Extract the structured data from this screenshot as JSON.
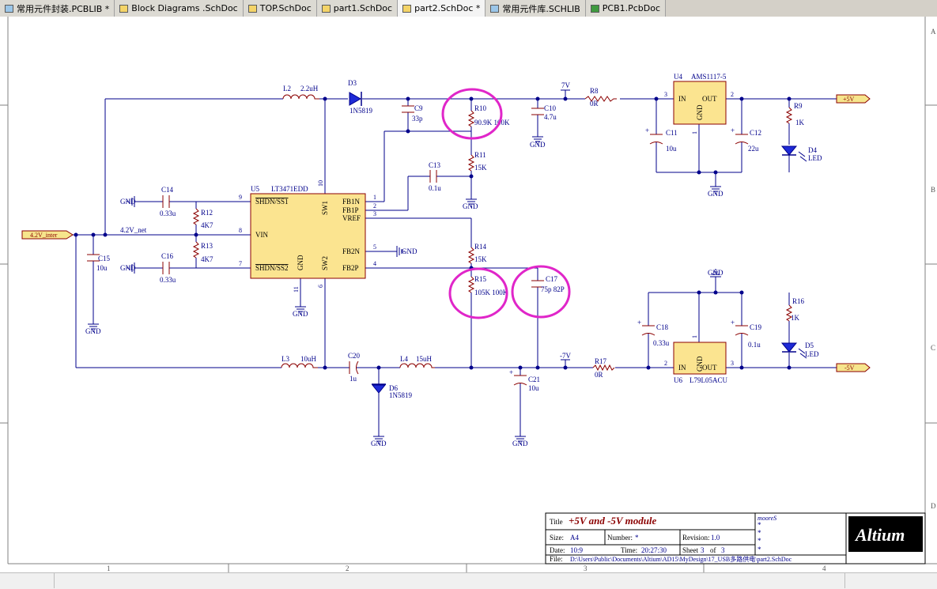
{
  "tabs": [
    {
      "label": "常用元件封装.PCBLIB *",
      "icon": "pcblib-icon",
      "active": false
    },
    {
      "label": "Block Diagrams .SchDoc",
      "icon": "schdoc-icon",
      "active": false
    },
    {
      "label": "TOP.SchDoc",
      "icon": "schdoc-icon",
      "active": false
    },
    {
      "label": "part1.SchDoc",
      "icon": "schdoc-icon",
      "active": false
    },
    {
      "label": "part2.SchDoc *",
      "icon": "schdoc-icon",
      "active": true
    },
    {
      "label": "常用元件库.SCHLIB",
      "icon": "schlib-icon",
      "active": false
    },
    {
      "label": "PCB1.PcbDoc",
      "icon": "pcbdoc-icon",
      "active": false
    }
  ],
  "border": {
    "cols": [
      "1",
      "2",
      "3",
      "4"
    ],
    "rows": [
      "A",
      "B",
      "C",
      "D"
    ]
  },
  "components": {
    "L2": {
      "ref": "L2",
      "val": "2.2uH"
    },
    "D3": {
      "ref": "D3",
      "val": "1N5819"
    },
    "C9": {
      "ref": "C9",
      "val": "33p"
    },
    "R10": {
      "ref": "R10",
      "val": "90.9K 100K"
    },
    "C10": {
      "ref": "C10",
      "val": "4.7u"
    },
    "R8": {
      "ref": "R8",
      "val": "0R"
    },
    "U4": {
      "ref": "U4",
      "val": "AMS1117-5",
      "in": "IN",
      "out": "OUT",
      "gnd": "GND"
    },
    "C11": {
      "ref": "C11",
      "val": "10u"
    },
    "C12": {
      "ref": "C12",
      "val": "22u"
    },
    "R9": {
      "ref": "R9",
      "val": "1K"
    },
    "D4": {
      "ref": "D4",
      "val": "LED"
    },
    "R11": {
      "ref": "R11",
      "val": "15K"
    },
    "C13": {
      "ref": "C13",
      "val": "0.1u"
    },
    "U5": {
      "ref": "U5",
      "val": "LT3471EDD"
    },
    "C14": {
      "ref": "C14",
      "val": "0.33u"
    },
    "R12": {
      "ref": "R12",
      "val": "4K7"
    },
    "R13": {
      "ref": "R13",
      "val": "4K7"
    },
    "C16": {
      "ref": "C16",
      "val": "0.33u"
    },
    "C15": {
      "ref": "C15",
      "val": "10u"
    },
    "R14": {
      "ref": "R14",
      "val": "15K"
    },
    "R15": {
      "ref": "R15",
      "val": "105K 100K"
    },
    "C17": {
      "ref": "C17",
      "val": "75p 82P"
    },
    "L3": {
      "ref": "L3",
      "val": "10uH"
    },
    "C20": {
      "ref": "C20",
      "val": "1u"
    },
    "L4": {
      "ref": "L4",
      "val": "15uH"
    },
    "D6": {
      "ref": "D6",
      "val": "1N5819"
    },
    "C21": {
      "ref": "C21",
      "val": "10u"
    },
    "R17": {
      "ref": "R17",
      "val": "0R"
    },
    "U6": {
      "ref": "U6",
      "val": "L79L05ACU",
      "in": "IN",
      "out": "OUT",
      "gnd": "GND"
    },
    "C18": {
      "ref": "C18",
      "val": "0.33u"
    },
    "C19": {
      "ref": "C19",
      "val": "0.1u"
    },
    "R16": {
      "ref": "R16",
      "val": "1K"
    },
    "D5": {
      "ref": "D5",
      "val": "LED"
    }
  },
  "u5_pins": {
    "shdn1": "SHDN/SS1",
    "shdn2": "SHDN/SS2",
    "vin": "VIN",
    "gnd": "GND",
    "sw1": "SW1",
    "sw2": "SW2",
    "fb1n": "FB1N",
    "fb1p": "FB1P",
    "vref": "VREF",
    "fb2n": "FB2N",
    "fb2p": "FB2P"
  },
  "pin_numbers": {
    "p1": "1",
    "p2": "2",
    "p3": "3",
    "p4": "4",
    "p5": "5",
    "p6": "6",
    "p7": "7",
    "p8": "8",
    "p9": "9",
    "p10": "10",
    "p11": "11"
  },
  "reg_pins": {
    "u4_in": "3",
    "u4_out": "2",
    "u4_gnd": "1",
    "u6_in": "2",
    "u6_out": "3",
    "u6_gnd": "1"
  },
  "nets": {
    "gnd": "GND",
    "v7": "7V",
    "vneg7": "-7V",
    "vin_net": "4.2V_net",
    "port_in": "4.2V_inter",
    "port_p5": "+5V",
    "port_n5": "-5V"
  },
  "title_block": {
    "title_label": "Title",
    "title": "+5V and -5V module",
    "size_label": "Size:",
    "size": "A4",
    "number_label": "Number:",
    "number": "*",
    "revision_label": "Revision:",
    "revision": "1.0",
    "date_label": "Date:",
    "date": "10:9",
    "time_label": "Time:",
    "time": "20:27:30",
    "sheet_label": "Sheet",
    "sheet": "3",
    "of_label": "of",
    "sheet_total": "3",
    "file_label": "File:",
    "file": "D:\\Users\\Public\\Documents\\Altium\\AD15\\MyDesign\\17_USB多路供电\\part2.SchDoc",
    "author": "mooreS",
    "stars": [
      "*",
      "*",
      "*",
      "*"
    ],
    "logo": "Altium"
  },
  "colors": {
    "wire": "#00008b",
    "part": "#8b0000",
    "body": "#fbe490",
    "highlight": "#e026c9",
    "port_fill": "#f6e58c"
  }
}
